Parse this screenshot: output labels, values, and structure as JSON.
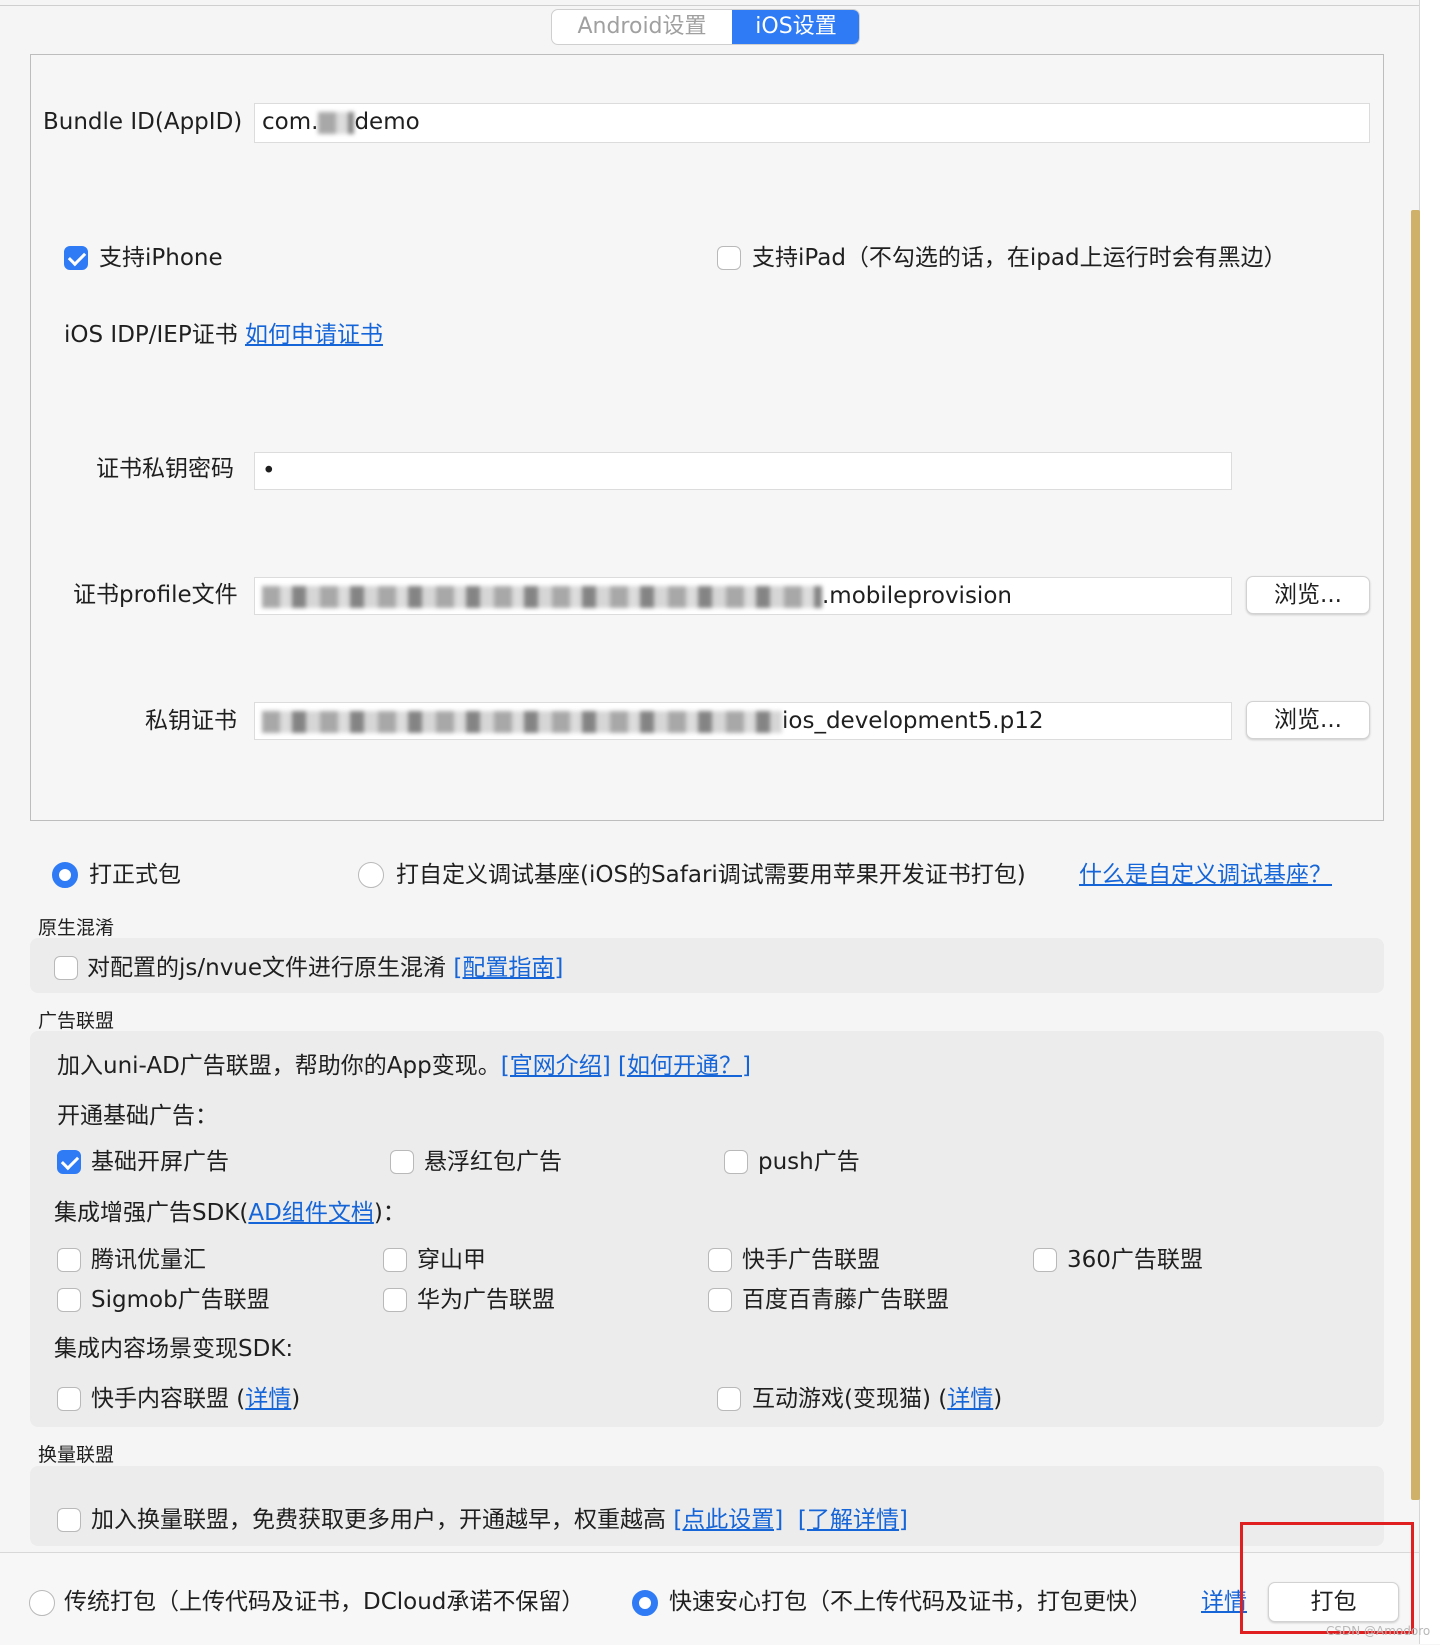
{
  "tabs": [
    {
      "label": "Android设置",
      "active": false
    },
    {
      "label": "iOS设置",
      "active": true
    }
  ],
  "ios": {
    "bundle_id_label": "Bundle ID(AppID)",
    "bundle_id_value_prefix": "com.",
    "bundle_id_value_suffix": "demo",
    "iphone_label": "支持iPhone",
    "iphone_checked": true,
    "ipad_label": "支持iPad",
    "ipad_note": "（不勾选的话，在ipad上运行时会有黑边）",
    "ipad_checked": false,
    "cert_label": "iOS IDP/IEP证书",
    "cert_link": "如何申请证书",
    "password_label": "证书私钥密码",
    "password_value": "•",
    "profile_label": "证书profile文件",
    "profile_value": ".mobileprovision",
    "private_cert_label": "私钥证书",
    "private_cert_value": "ios_development5.p12",
    "browse_label": "浏览..."
  },
  "package_type": {
    "formal_label": "打正式包",
    "formal_selected": true,
    "custom_label": "打自定义调试基座(iOS的Safari调试需要用苹果开发证书打包)",
    "custom_selected": false,
    "custom_link": "什么是自定义调试基座？"
  },
  "obfuscation": {
    "section_title": "原生混淆",
    "checkbox_label": "对配置的js/nvue文件进行原生混淆",
    "guide_link": "[配置指南]",
    "checked": false
  },
  "ad": {
    "section_title": "广告联盟",
    "intro": "加入uni-AD广告联盟，帮助你的App变现。",
    "intro_link1": "[官网介绍]",
    "intro_link2": "[如何开通？]",
    "basic_title": "开通基础广告：",
    "basic": [
      {
        "label": "基础开屏广告",
        "checked": true
      },
      {
        "label": "悬浮红包广告",
        "checked": false
      },
      {
        "label": "push广告",
        "checked": false
      }
    ],
    "enhanced_title_prefix": "集成增强广告SDK(",
    "enhanced_link": "AD组件文档",
    "enhanced_title_suffix": ")：",
    "enhanced": [
      {
        "label": "腾讯优量汇",
        "checked": false
      },
      {
        "label": "穿山甲",
        "checked": false
      },
      {
        "label": "快手广告联盟",
        "checked": false
      },
      {
        "label": "360广告联盟",
        "checked": false
      },
      {
        "label": "Sigmob广告联盟",
        "checked": false
      },
      {
        "label": "华为广告联盟",
        "checked": false
      },
      {
        "label": "百度百青藤广告联盟",
        "checked": false
      }
    ],
    "content_title": "集成内容场景变现SDK:",
    "content": [
      {
        "label_prefix": "快手内容联盟 (",
        "link": "详情",
        "label_suffix": ")",
        "checked": false
      },
      {
        "label_prefix": "互动游戏(变现猫) (",
        "link": "详情",
        "label_suffix": ")",
        "checked": false
      }
    ]
  },
  "exchange": {
    "section_title": "换量联盟",
    "checkbox_label": "加入换量联盟，免费获取更多用户，开通越早，权重越高",
    "link1": "[点此设置]",
    "link2": "[了解详情]",
    "checked": false
  },
  "footer": {
    "traditional_label": "传统打包（上传代码及证书，DCloud承诺不保留）",
    "traditional_selected": false,
    "fast_label": "快速安心打包（不上传代码及证书，打包更快）",
    "fast_selected": true,
    "details_link": "详情",
    "pack_button": "打包",
    "watermark": "CSDN @Amodoro"
  },
  "colors": {
    "accent": "#2f7bf6",
    "link": "#1565d8",
    "highlight_box": "#e02020",
    "scrollbar": "#cfb16a"
  }
}
